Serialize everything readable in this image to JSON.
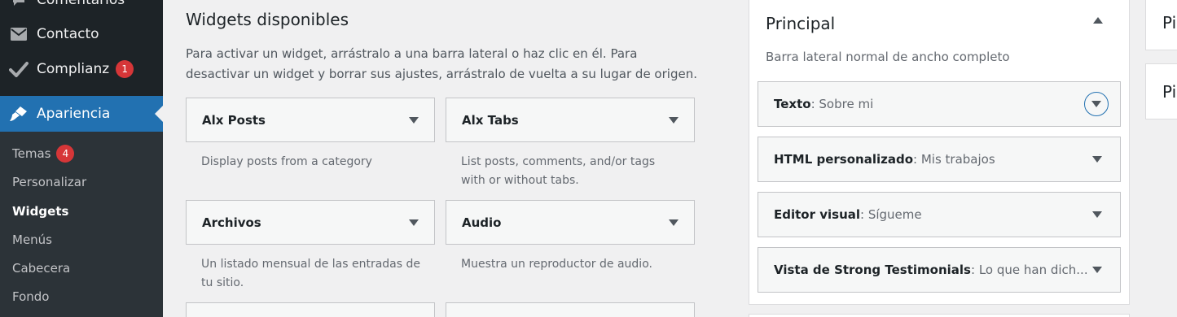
{
  "sidebar": {
    "items": [
      {
        "label": "Comentarios",
        "icon": "comment-icon"
      },
      {
        "label": "Contacto",
        "icon": "mail-icon"
      },
      {
        "label": "Complianz",
        "icon": "check-icon",
        "badge": "1"
      },
      {
        "label": "Apariencia",
        "icon": "paintbrush-icon",
        "active": true
      }
    ],
    "submenu": [
      {
        "label": "Temas",
        "badge": "4"
      },
      {
        "label": "Personalizar"
      },
      {
        "label": "Widgets",
        "current": true
      },
      {
        "label": "Menús"
      },
      {
        "label": "Cabecera"
      },
      {
        "label": "Fondo"
      }
    ]
  },
  "available": {
    "title": "Widgets disponibles",
    "description": "Para activar un widget, arrástralo a una barra lateral o haz clic en él. Para desactivar un widget y borrar sus ajustes, arrástralo de vuelta a su lugar de origen.",
    "widgets": [
      {
        "title": "Alx Posts",
        "description": "Display posts from a category"
      },
      {
        "title": "Alx Tabs",
        "description": "List posts, comments, and/or tags with or without tabs."
      },
      {
        "title": "Archivos",
        "description": "Un listado mensual de las entradas de tu sitio."
      },
      {
        "title": "Audio",
        "description": "Muestra un reproductor de audio."
      }
    ]
  },
  "principal": {
    "title": "Principal",
    "description": "Barra lateral normal de ancho completo",
    "widgets": [
      {
        "type": "Texto",
        "name": "Sobre mi"
      },
      {
        "type": "HTML personalizado",
        "name": "Mis trabajos"
      },
      {
        "type": "Editor visual",
        "name": "Sígueme"
      },
      {
        "type": "Vista de Strong Testimonials",
        "name": "Lo que han dich..."
      }
    ]
  },
  "right_panels": [
    {
      "title": "Pie"
    },
    {
      "title": "Pie"
    }
  ],
  "colors": {
    "sidebar_bg": "#1d2327",
    "accent": "#2271b1",
    "badge": "#d63638"
  }
}
